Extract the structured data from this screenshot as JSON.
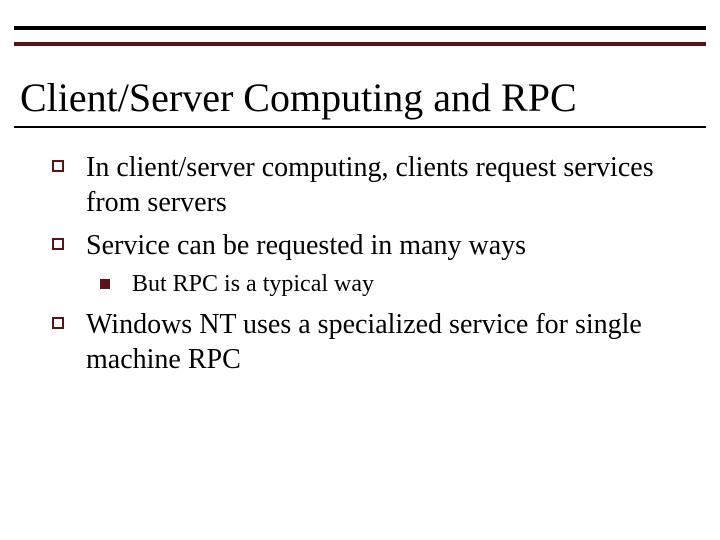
{
  "title": "Client/Server Computing and RPC",
  "bullets": {
    "b1": "In client/server computing, clients request services from servers",
    "b2": "Service can be requested in many ways",
    "b2_sub1": "But RPC is a typical way",
    "b3": "Windows NT uses a specialized service for single machine RPC"
  }
}
